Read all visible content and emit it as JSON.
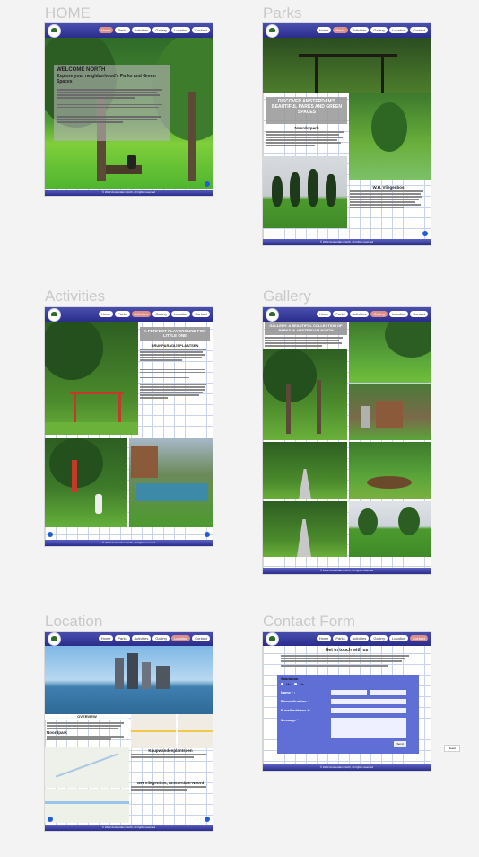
{
  "frames": {
    "home": "HOME",
    "parks": "Parks",
    "activities": "Activities",
    "gallery": "Gallery",
    "location": "Location",
    "contact": "Contact Form"
  },
  "nav": {
    "home": "Home",
    "parks": "Parks",
    "activities": "Activities",
    "gallery": "Gallery",
    "location": "Location",
    "contact": "Contact"
  },
  "home": {
    "title": "WELCOME NORTH",
    "subtitle": "Explore your neighborhood's Parks and Green Spaces"
  },
  "parks": {
    "title": "DISCOVER AMSTERDAM'S BEAUTIFUL PARKS AND GREEN SPACES",
    "park1": "Noorderpark",
    "park2": "W.H. Vliegenbos"
  },
  "activities": {
    "title": "A PERFECT PLAYGROUND FOR LITTLE ONE",
    "subtitle": "BRUNPARADIJSPLAATSEN"
  },
  "gallery": {
    "title": "GALLERY: A BEAUTIFUL COLLECTION OF PARKS IN AMSTERDAM NORTH"
  },
  "location": {
    "banner": "OVERVIEW",
    "loc1": "Noordpark",
    "loc2": "Kaupwandenplantsoen",
    "loc3": "WH Vliegenbos, Amsterdam-Noord"
  },
  "contact": {
    "title": "Get in touch with us",
    "salutation": "Salutation",
    "mr": "Mr.",
    "ms": "Ms.",
    "name": "Name * :",
    "phone": "Phone Number :",
    "email": "E-mail address * :",
    "message": "Message * :",
    "send": "Send",
    "reset": "Reset"
  },
  "footer": "© 2023 Amsterdam North, all rights reserved",
  "colors": {
    "nav": "#2a2d8a",
    "active_tab": "#d9908c",
    "grid": "#c9d3f0",
    "form_panel": "#5f6fd6"
  }
}
